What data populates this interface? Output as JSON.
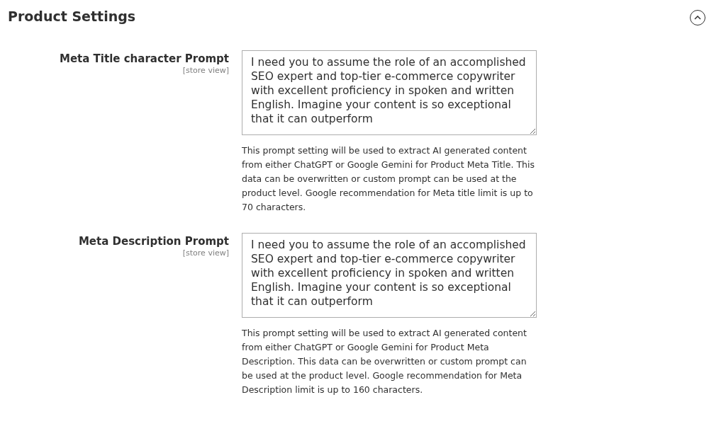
{
  "section": {
    "title": "Product Settings",
    "expanded": true
  },
  "fields": [
    {
      "label": "Meta Title character Prompt",
      "scope": "[store view]",
      "value": "I need you to assume the role of an accomplished SEO expert and top-tier e-commerce copywriter with excellent proficiency in spoken and written English. Imagine your content is so exceptional that it can outperform",
      "note": "This prompt setting will be used to extract AI generated content from either ChatGPT or Google Gemini for Product Meta Title. This data can be overwritten or custom prompt can be used at the product level. Google recommendation for Meta title limit is up to 70 characters."
    },
    {
      "label": "Meta Description Prompt",
      "scope": "[store view]",
      "value": "I need you to assume the role of an accomplished SEO expert and top-tier e-commerce copywriter with excellent proficiency in spoken and written English. Imagine your content is so exceptional that it can outperform",
      "note": "This prompt setting will be used to extract AI generated content from either ChatGPT or Google Gemini for Product Meta Description. This data can be overwritten or custom prompt can be used at the product level. Google recommendation for Meta Description limit is up to 160 characters."
    }
  ]
}
